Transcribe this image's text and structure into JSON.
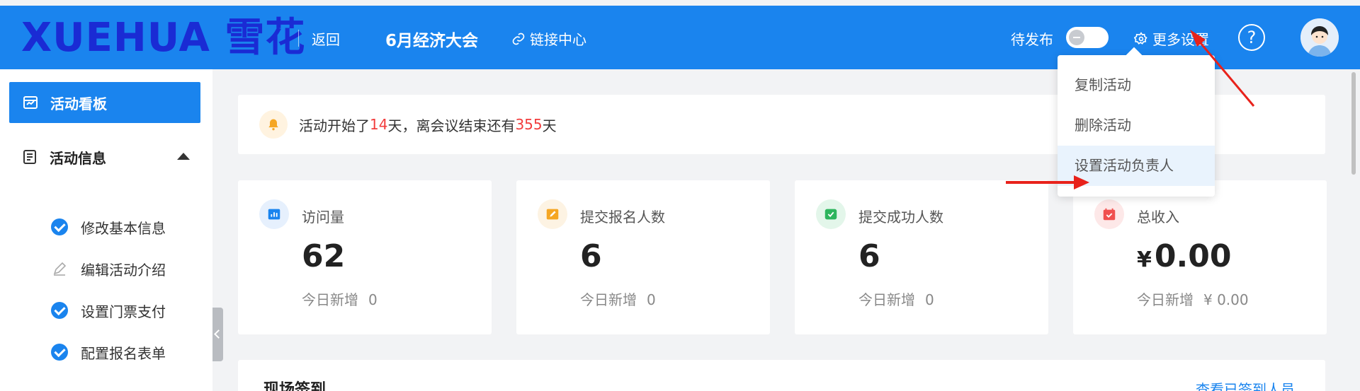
{
  "header": {
    "logo": "XUEHUA 雪花",
    "back_label": "返回",
    "event_title": "6月经济大会",
    "link_center_label": "链接中心",
    "pending_label": "待发布",
    "settings_label": "更多设置",
    "help_symbol": "?",
    "toggle_on": false,
    "icons": {
      "link": "link-icon",
      "settings": "gear-icon",
      "help": "question-icon",
      "avatar": "avatar-icon"
    }
  },
  "sidebar": {
    "active_item": "活动看板",
    "group_label": "活动信息",
    "items": [
      {
        "label": "修改基本信息",
        "status": "done"
      },
      {
        "label": "编辑活动介绍",
        "status": "todo"
      },
      {
        "label": "设置门票支付",
        "status": "done"
      },
      {
        "label": "配置报名表单",
        "status": "done"
      }
    ]
  },
  "notice": {
    "prefix": "活动开始了",
    "days_started": "14",
    "middle": "天，离会议结束还有",
    "days_left": "355",
    "suffix": "天"
  },
  "stats": [
    {
      "label": "访问量",
      "value": "62",
      "sub_label": "今日新增",
      "sub_value": "0",
      "icon": "chart-icon",
      "color": "#1a84ee"
    },
    {
      "label": "提交报名人数",
      "value": "6",
      "sub_label": "今日新增",
      "sub_value": "0",
      "icon": "edit-icon",
      "color": "#f5a623"
    },
    {
      "label": "提交成功人数",
      "value": "6",
      "sub_label": "今日新增",
      "sub_value": "0",
      "icon": "check-square-icon",
      "color": "#2db55d"
    },
    {
      "label": "总收入",
      "currency": "¥",
      "value": "0.00",
      "sub_label": "今日新增",
      "sub_value": "¥ 0.00",
      "icon": "calendar-icon",
      "color": "#f0504f"
    }
  ],
  "checkin": {
    "title": "现场签到",
    "link": "查看已签到人员"
  },
  "dropdown": {
    "items": [
      "复制活动",
      "删除活动",
      "设置活动负责人"
    ],
    "highlighted_index": 2
  },
  "colors": {
    "primary": "#1a84ee",
    "accent_red": "#f23c3c"
  }
}
